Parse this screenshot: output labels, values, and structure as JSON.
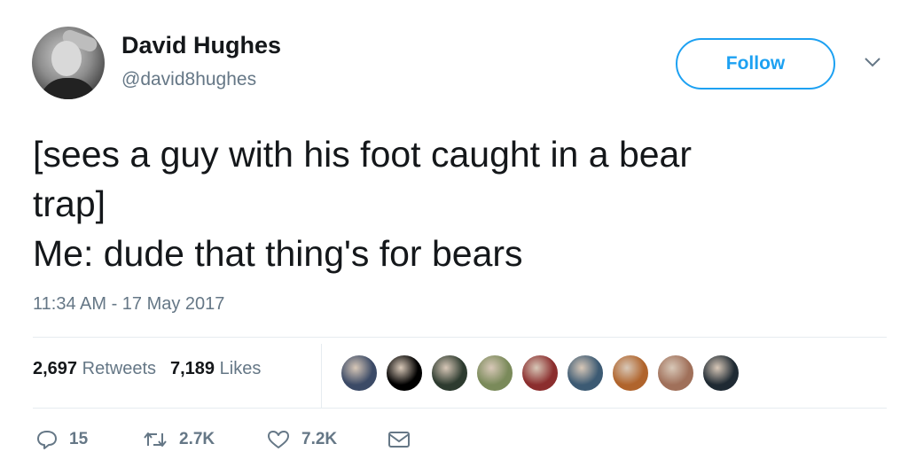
{
  "author": {
    "name": "David Hughes",
    "handle": "@david8hughes"
  },
  "follow_label": "Follow",
  "tweet": {
    "lines": [
      "[sees a guy with his foot caught in a bear",
      "trap]",
      "Me: dude that thing's for bears"
    ],
    "timestamp": "11:34 AM - 17 May 2017"
  },
  "stats": {
    "retweets_count": "2,697",
    "retweets_label": "Retweets",
    "likes_count": "7,189",
    "likes_label": "Likes"
  },
  "likers": [
    {
      "color": "#3b4a66"
    },
    {
      "color": "#000000"
    },
    {
      "color": "#2d3b2f"
    },
    {
      "color": "#7a8a5a"
    },
    {
      "color": "#8b2e2e"
    },
    {
      "color": "#3c5a73"
    },
    {
      "color": "#b0642c"
    },
    {
      "color": "#a0705a"
    },
    {
      "color": "#1f2a33"
    }
  ],
  "actions": {
    "replies": "15",
    "retweets": "2.7K",
    "likes": "7.2K"
  },
  "colors": {
    "accent": "#1da1f2",
    "secondary_text": "#657786",
    "primary_text": "#14171a"
  },
  "icons": [
    "chevron-down-icon",
    "reply-icon",
    "retweet-icon",
    "heart-icon",
    "message-icon"
  ]
}
